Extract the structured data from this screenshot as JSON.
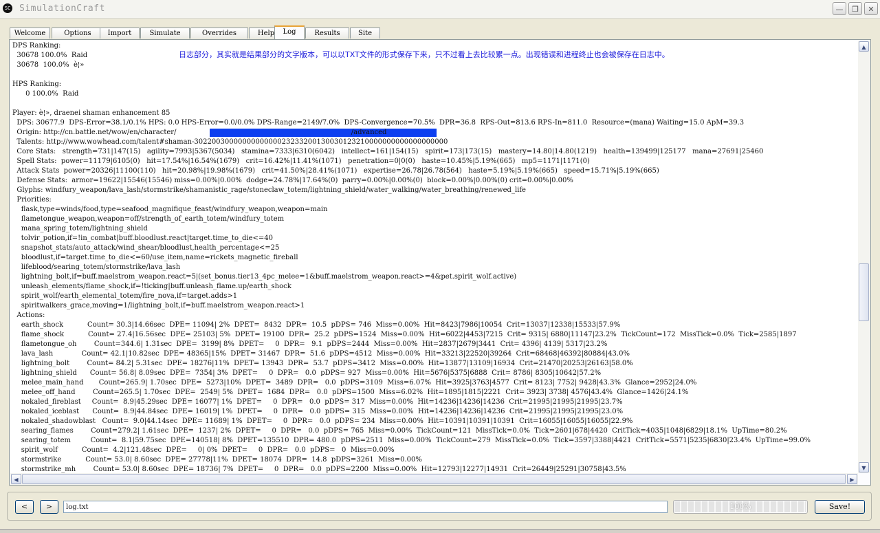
{
  "window": {
    "title": "SimulationCraft",
    "icon": "SC"
  },
  "tabs": [
    "Welcome",
    "Options",
    "Import",
    "Simulate",
    "Overrides",
    "Help",
    "Log",
    "Results",
    "Site"
  ],
  "active_tab": "Log",
  "note": "日志部分，其实就是结果部分的文字版本，可以以TXT文件的形式保存下来，只不过看上去比较累一点。出现错误和进程终止也会被保存在日志中。",
  "log_lines": [
    "DPS Ranking:",
    "  30678 100.0%  Raid",
    "  30678  100.0%  è¦»",
    "",
    "HPS Ranking:",
    "      0 100.0%  Raid",
    "",
    "Player: è¦», draenei shaman enhancement 85",
    "  DPS: 30677.9  DPS-Error=38.1/0.1% HPS: 0.0 HPS-Error=0.0/0.0% DPS-Range=2149/7.0%  DPS-Convergence=70.5%  DPR=36.8  RPS-Out=813.6 RPS-In=811.0  Resource=(mana) Waiting=15.0 ApM=39.3",
    "  Origin: http://cn.battle.net/wow/en/character/                                                                                /advanced",
    "  Talents: http://www.wowhead.com/talent#shaman-3022003000000000000023233200130030123210000000000000000000",
    "  Core Stats:   strength=731|147(15)   agility=7993|5367(5034)   stamina=7333|6310(6042)   intellect=161|154(15)   spirit=173|173(15)   mastery=14.80|14.80(1219)   health=139499|125177   mana=27691|25460",
    "  Spell Stats:  power=11179|6105(0)   hit=17.54%|16.54%(1679)   crit=16.42%|11.41%(1071)   penetration=0|0(0)   haste=10.45%|5.19%(665)   mp5=1171|1171(0)",
    "  Attack Stats  power=20326|11100(110)   hit=20.98%|19.98%(1679)   crit=41.50%|28.41%(1071)   expertise=26.78|26.78(564)   haste=5.19%|5.19%(665)   speed=15.71%|5.19%(665)",
    "  Defense Stats:  armor=19622|15546(15546) miss=0.00%|0.00%  dodge=24.78%|17.64%(0)  parry=0.00%|0.00%(0)  block=0.00%|0.00%(0) crit=0.00%|0.00%",
    "  Glyphs: windfury_weapon/lava_lash/stormstrike/shamanistic_rage/stoneclaw_totem/lightning_shield/water_walking/water_breathing/renewed_life",
    "  Priorities:",
    "    flask,type=winds/food,type=seafood_magnifique_feast/windfury_weapon,weapon=main",
    "    flametongue_weapon,weapon=off/strength_of_earth_totem/windfury_totem",
    "    mana_spring_totem/lightning_shield",
    "    tolvir_potion,if=!in_combat|buff.bloodlust.react|target.time_to_die<=40",
    "    snapshot_stats/auto_attack/wind_shear/bloodlust,health_percentage<=25",
    "    bloodlust,if=target.time_to_die<=60/use_item,name=rickets_magnetic_fireball",
    "    lifeblood/searing_totem/stormstrike/lava_lash",
    "    lightning_bolt,if=buff.maelstrom_weapon.react=5|(set_bonus.tier13_4pc_melee=1&buff.maelstrom_weapon.react>=4&pet.spirit_wolf.active)",
    "    unleash_elements/flame_shock,if=!ticking|buff.unleash_flame.up/earth_shock",
    "    spirit_wolf/earth_elemental_totem/fire_nova,if=target.adds>1",
    "    spiritwalkers_grace,moving=1/lightning_bolt,if=buff.maelstrom_weapon.react>1",
    "  Actions:",
    "    earth_shock           Count= 30.3|14.66sec  DPE= 11094| 2%  DPET=  8432  DPR=  10.5  pDPS= 746  Miss=0.00%  Hit=8423|7986|10054  Crit=13037|12338|15533|57.9%",
    "    flame_shock           Count= 27.4|16.56sec  DPE= 25103| 5%  DPET= 19100  DPR=  25.2  pDPS=1524  Miss=0.00%  Hit=6022|4453|7215  Crit= 9315| 6880|11147|23.2%  TickCount=172  MissTick=0.0%  Tick=2585|1897",
    "    flametongue_oh        Count=344.6| 1.31sec  DPE=  3199| 8%  DPET=     0  DPR=   9.1  pDPS=2444  Miss=0.00%  Hit=2837|2679|3441  Crit= 4396| 4139| 5317|23.2%",
    "    lava_lash             Count= 42.1|10.82sec  DPE= 48365|15%  DPET= 31467  DPR=  51.6  pDPS=4512  Miss=0.00%  Hit=33213|22520|39264  Crit=68468|46392|80884|43.0%",
    "    lightning_bolt        Count= 84.2| 5.31sec  DPE= 18276|11%  DPET= 13943  DPR=  53.7  pDPS=3412  Miss=0.00%  Hit=13877|13109|16934  Crit=21470|20253|26163|58.0%",
    "    lightning_shield      Count= 56.8| 8.09sec  DPE=  7354| 3%  DPET=     0  DPR=   0.0  pDPS= 927  Miss=0.00%  Hit=5676|5375|6888  Crit= 8786| 8305|10642|57.2%",
    "    melee_main_hand       Count=265.9| 1.70sec  DPE=  5273|10%  DPET=  3489  DPR=   0.0  pDPS=3109  Miss=6.07%  Hit=3925|3763|4577  Crit= 8123| 7752| 9428|43.3%  Glance=2952|24.0%",
    "    melee_off_hand        Count=265.5| 1.70sec  DPE=  2549| 5%  DPET=  1684  DPR=   0.0  pDPS=1500  Miss=6.02%  Hit=1895|1815|2221  Crit= 3923| 3738| 4576|43.4%  Glance=1426|24.1%",
    "    nokaled_fireblast     Count=  8.9|45.29sec  DPE= 16077| 1%  DPET=     0  DPR=   0.0  pDPS= 317  Miss=0.00%  Hit=14236|14236|14236  Crit=21995|21995|21995|23.7%",
    "    nokaled_iceblast      Count=  8.9|44.84sec  DPE= 16019| 1%  DPET=     0  DPR=   0.0  pDPS= 315  Miss=0.00%  Hit=14236|14236|14236  Crit=21995|21995|21995|23.0%",
    "    nokaled_shadowblast   Count=  9.0|44.14sec  DPE= 11689| 1%  DPET=     0  DPR=   0.0  pDPS= 234  Miss=0.00%  Hit=10391|10391|10391  Crit=16055|16055|16055|22.9%",
    "    searing_flames        Count=279.2| 1.61sec  DPE=  1237| 2%  DPET=     0  DPR=   0.0  pDPS= 765  Miss=0.00%  TickCount=121  MissTick=0.0%  Tick=2601|678|4420  CritTick=4035|1048|6829|18.1%  UpTime=80.2%",
    "    searing_totem         Count=  8.1|59.75sec  DPE=140518| 8%  DPET=135510  DPR= 480.0  pDPS=2511  Miss=0.00%  TickCount=279  MissTick=0.0%  Tick=3597|3388|4421  CritTick=5571|5235|6830|23.4%  UpTime=99.0%",
    "    spirit_wolf           Count=  4.2|121.48sec  DPE=     0| 0%  DPET=     0  DPR=   0.0  pDPS=   0  Miss=0.00%",
    "    stormstrike           Count= 53.0| 8.60sec  DPE= 27778|11%  DPET= 18074  DPR=  14.8  pDPS=3261  Miss=0.00%",
    "    stormstrike_mh        Count= 53.0| 8.60sec  DPE= 18736| 7%  DPET=     0  DPR=   0.0  pDPS=2200  Miss=0.00%  Hit=12793|12277|14931  Crit=26449|25291|30758|43.5%"
  ],
  "bottom": {
    "back": "<",
    "forward": ">",
    "filename": "log.txt",
    "progress_percent": 100,
    "progress_label": "100%",
    "save_label": "Save!"
  },
  "icons": {
    "minimize": "minimize-icon",
    "maximize": "maximize-icon",
    "close": "close-icon"
  },
  "colors": {
    "note_text": "#1a1adb",
    "redaction": "#0d3ff0",
    "active_tab_accent": "#e8a236"
  }
}
